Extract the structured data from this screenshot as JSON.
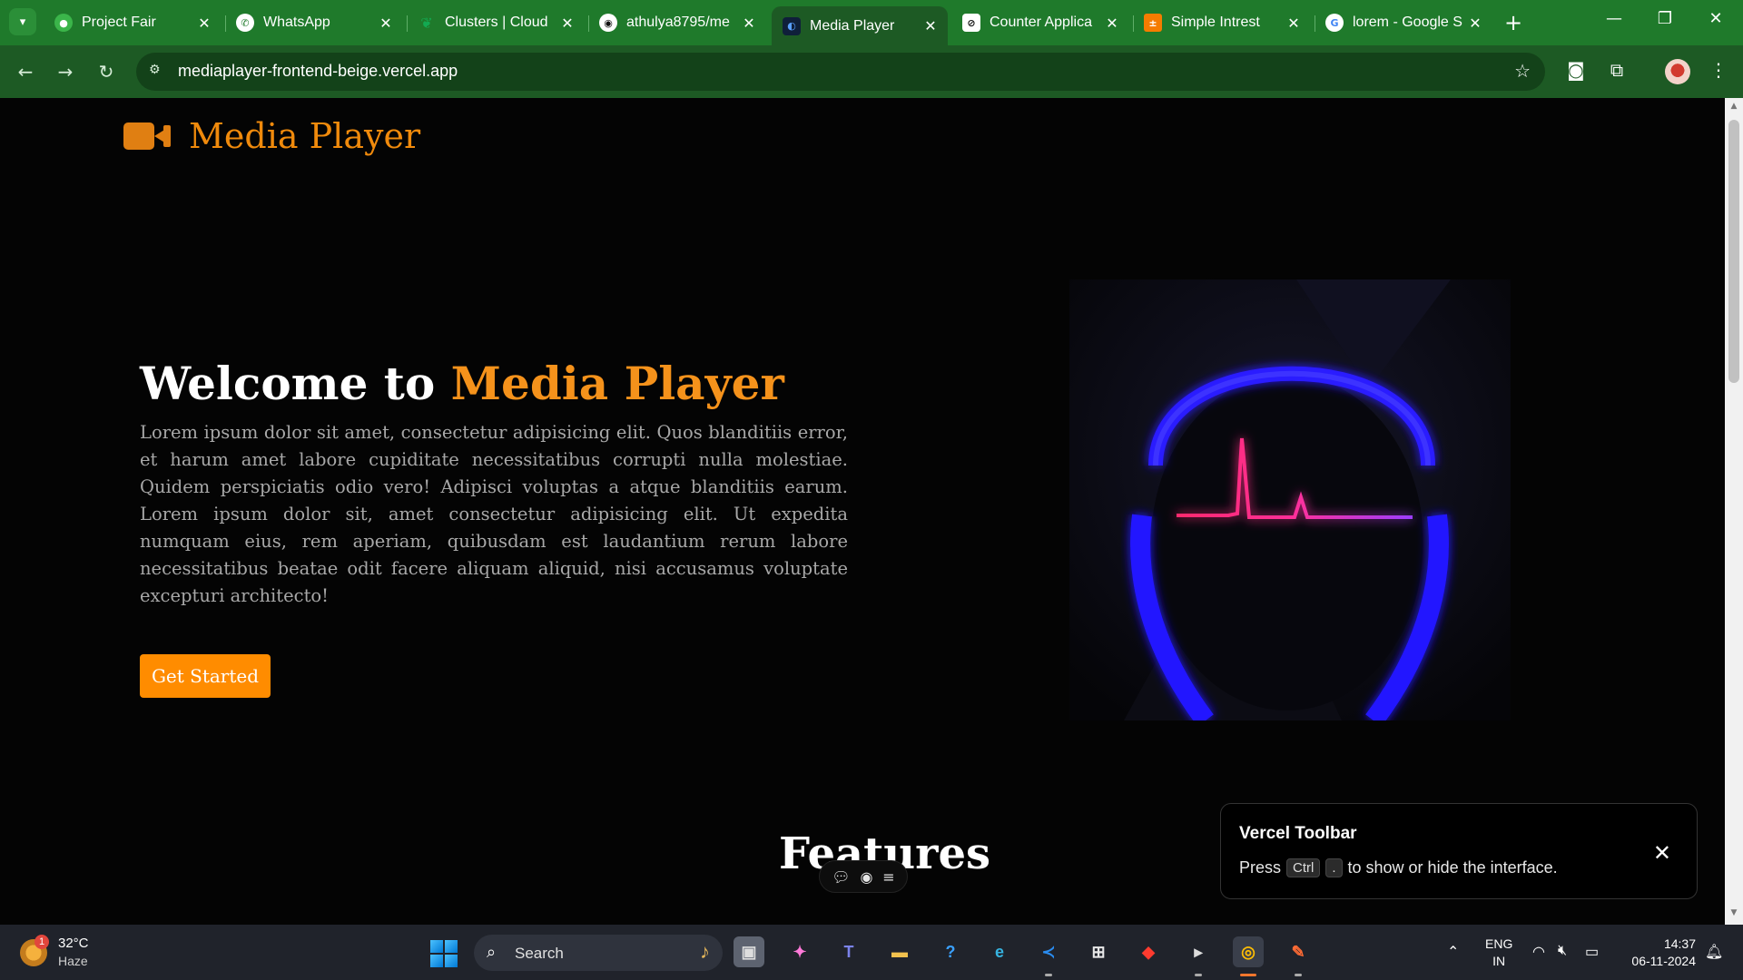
{
  "browser": {
    "tabs": [
      {
        "title": "Project Fair",
        "icon": "project-fair-favicon",
        "active": false
      },
      {
        "title": "WhatsApp",
        "icon": "whatsapp-icon",
        "active": false
      },
      {
        "title": "Clusters | Cloud",
        "icon": "mongodb-leaf-icon",
        "active": false
      },
      {
        "title": "athulya8795/me",
        "icon": "github-icon",
        "active": false
      },
      {
        "title": "Media Player",
        "icon": "media-player-favicon",
        "active": true
      },
      {
        "title": "Counter Applica",
        "icon": "counter-app-favicon",
        "active": false
      },
      {
        "title": "Simple Intrest",
        "icon": "simple-interest-favicon",
        "active": false
      },
      {
        "title": "lorem - Google S",
        "icon": "google-icon",
        "active": false
      }
    ],
    "url": "mediaplayer-frontend-beige.vercel.app",
    "colors": {
      "frame": "#1f7a2b",
      "toolbar": "#1d5a24"
    }
  },
  "page": {
    "brand": "Media Player",
    "hero": {
      "title_prefix": "Welcome to",
      "title_accent": "Media Player",
      "body": "Lorem ipsum dolor sit amet, consectetur adipisicing elit. Quos blanditiis error, et harum amet labore cupiditate necessitatibus corrupti nulla molestiae. Quidem perspiciatis odio vero! Adipisci voluptas a atque blanditiis earum. Lorem ipsum dolor sit, amet consectetur adipisicing elit. Ut expedita numquam eius, rem aperiam, quibusdam est laudantium rerum labore necessitatibus beatae odit facere aliquam aliquid, nisi accusamus voluptate excepturi architecto!",
      "cta": "Get Started"
    },
    "features_heading": "Features",
    "accent_color": "#f5921b"
  },
  "vercel_toolbar": {
    "title": "Vercel Toolbar",
    "msg_before": "Press",
    "key1": "Ctrl",
    "key2": ".",
    "msg_after": "to show or hide the interface."
  },
  "taskbar": {
    "weather_temp": "32°C",
    "weather_cond": "Haze",
    "weather_badge": "1",
    "search_label": "Search",
    "lang_line1": "ENG",
    "lang_line2": "IN",
    "time": "14:37",
    "date": "06-11-2024"
  }
}
